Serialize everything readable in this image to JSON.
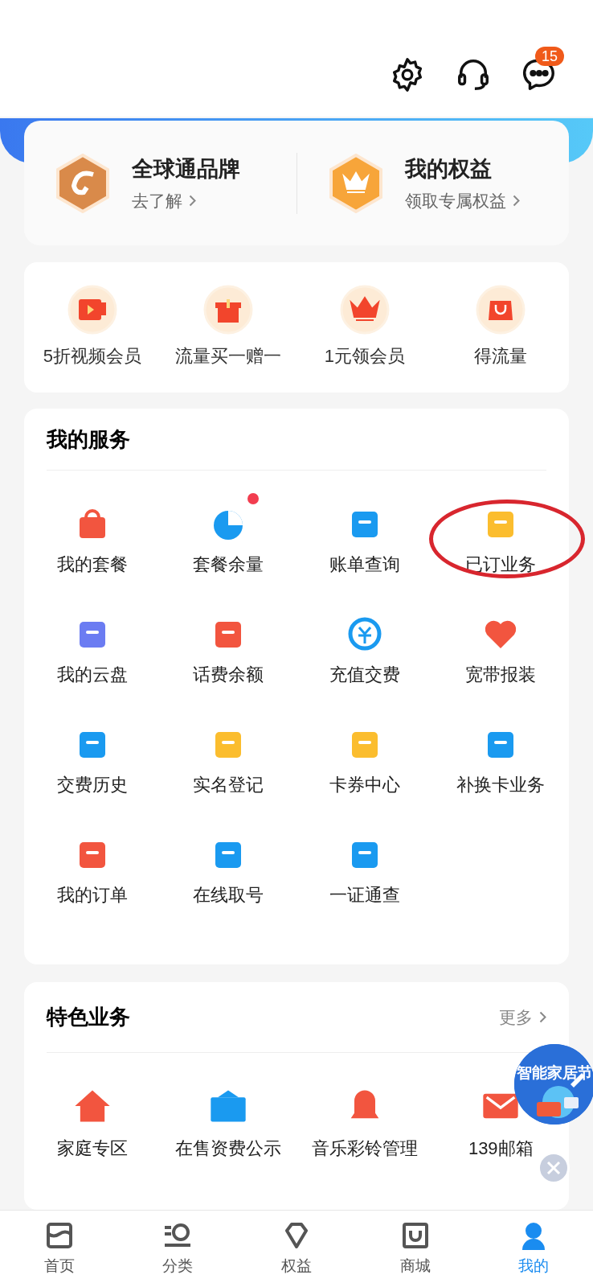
{
  "header": {
    "message_badge": "15"
  },
  "brand_cards": [
    {
      "title": "全球通品牌",
      "link": "去了解"
    },
    {
      "title": "我的权益",
      "link": "领取专属权益"
    }
  ],
  "promos": [
    {
      "label": "5折视频会员"
    },
    {
      "label": "流量买一赠一"
    },
    {
      "label": "1元领会员"
    },
    {
      "label": "得流量"
    }
  ],
  "services": {
    "title": "我的服务",
    "items": [
      {
        "label": "我的套餐",
        "dot": false,
        "circled": false
      },
      {
        "label": "套餐余量",
        "dot": true,
        "circled": false
      },
      {
        "label": "账单查询",
        "dot": false,
        "circled": false
      },
      {
        "label": "已订业务",
        "dot": false,
        "circled": true
      },
      {
        "label": "我的云盘",
        "dot": false,
        "circled": false
      },
      {
        "label": "话费余额",
        "dot": false,
        "circled": false
      },
      {
        "label": "充值交费",
        "dot": false,
        "circled": false
      },
      {
        "label": "宽带报装",
        "dot": false,
        "circled": false
      },
      {
        "label": "交费历史",
        "dot": false,
        "circled": false
      },
      {
        "label": "实名登记",
        "dot": false,
        "circled": false
      },
      {
        "label": "卡券中心",
        "dot": false,
        "circled": false
      },
      {
        "label": "补换卡业务",
        "dot": false,
        "circled": false
      },
      {
        "label": "我的订单",
        "dot": false,
        "circled": false
      },
      {
        "label": "在线取号",
        "dot": false,
        "circled": false
      },
      {
        "label": "一证通查",
        "dot": false,
        "circled": false
      }
    ]
  },
  "features": {
    "title": "特色业务",
    "more": "更多",
    "items": [
      {
        "label": "家庭专区"
      },
      {
        "label": "在售资费公示"
      },
      {
        "label": "音乐彩铃管理"
      },
      {
        "label": "139邮箱"
      }
    ]
  },
  "floating_ad": {
    "title": "智能家居节"
  },
  "nav": [
    {
      "label": "首页",
      "selected": false
    },
    {
      "label": "分类",
      "selected": false
    },
    {
      "label": "权益",
      "selected": false
    },
    {
      "label": "商城",
      "selected": false
    },
    {
      "label": "我的",
      "selected": true
    }
  ]
}
